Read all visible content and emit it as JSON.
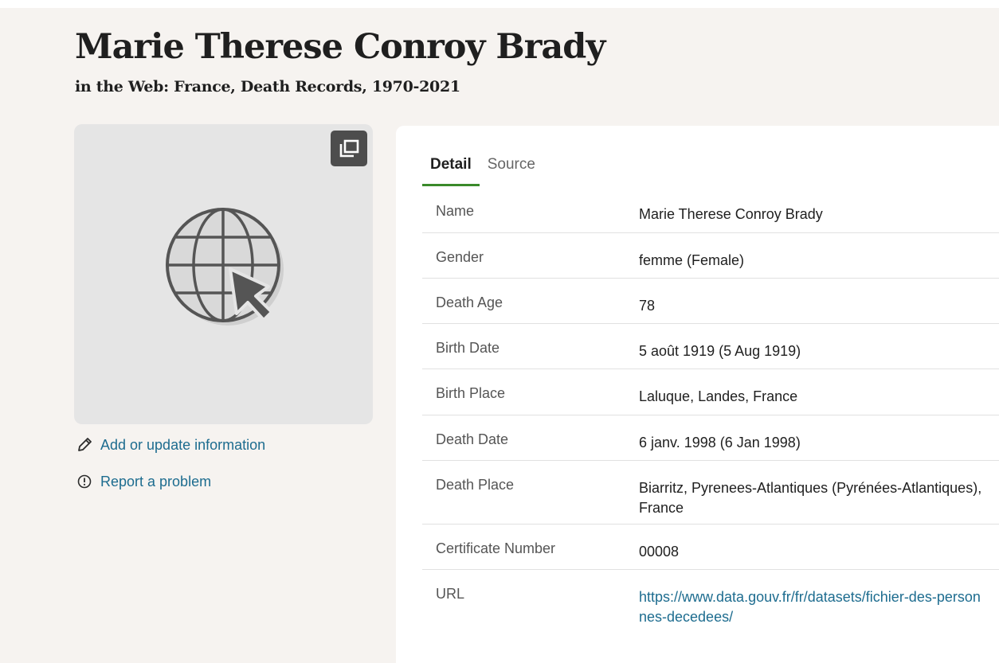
{
  "header": {
    "title": "Marie Therese Conroy Brady",
    "subtitle": "in the Web: France, Death Records, 1970-2021"
  },
  "media": {
    "expand_icon": "expand-icon",
    "globe_icon": "globe-cursor-icon"
  },
  "actions": {
    "add_update": "Add or update information",
    "report": "Report a problem"
  },
  "tabs": [
    {
      "label": "Detail",
      "active": true
    },
    {
      "label": "Source",
      "active": false
    }
  ],
  "details": {
    "name": {
      "label": "Name",
      "value": "Marie Therese Conroy Brady"
    },
    "gender": {
      "label": "Gender",
      "value": "femme (Female)"
    },
    "death_age": {
      "label": "Death Age",
      "value": "78"
    },
    "birth_date": {
      "label": "Birth Date",
      "value": "5 août 1919 (5 Aug 1919)"
    },
    "birth_place": {
      "label": "Birth Place",
      "value": "Laluque, Landes, France"
    },
    "death_date": {
      "label": "Death Date",
      "value": "6 janv. 1998 (6 Jan 1998)"
    },
    "death_place": {
      "label": "Death Place",
      "value": "Biarritz, Pyrenees-Atlantiques (Pyrénées-Atlantiques), France"
    },
    "certificate": {
      "label": "Certificate Number",
      "value": "00008"
    },
    "url": {
      "label": "URL",
      "value": "https://www.data.gouv.fr/fr/datasets/fichier-des-personnes-decedees/"
    }
  },
  "colors": {
    "page_bg": "#f6f3f0",
    "link": "#1d6c8f",
    "tab_underline": "#3a8a2a"
  }
}
